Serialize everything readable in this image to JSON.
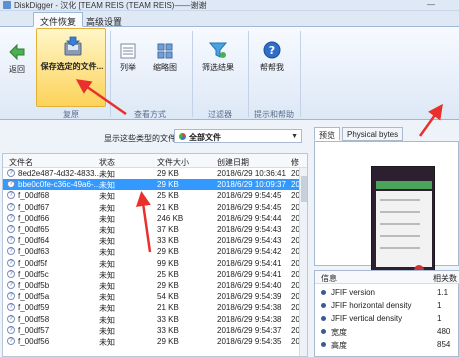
{
  "window": {
    "title": "DiskDigger - 汉化 [TEAM REIS (TEAM REIS)——谢谢",
    "minimize": "—"
  },
  "ribbon": {
    "tabs": [
      {
        "label": "文件恢复"
      },
      {
        "label": "高级设置"
      }
    ],
    "buttons": {
      "back": "返回",
      "save": "保存选定的文件...",
      "list": "列举",
      "thumbs": "缩略图",
      "filter": "筛选结果",
      "help": "帮帮我"
    },
    "groups": {
      "recover": "复原",
      "view": "查看方式",
      "filter": "过滤器",
      "help": "提示和帮助"
    }
  },
  "filter": {
    "label": "显示这些类型的文件：",
    "value": "全部文件"
  },
  "table": {
    "columns": {
      "name": "文件名",
      "status": "状态",
      "size": "文件大小",
      "created": "创建日期",
      "modified": "修"
    },
    "rows": [
      {
        "name": "8ed2e487-4d32-4833...",
        "status": "未知",
        "size": "29 KB",
        "created": "2018/6/29 10:36:41",
        "modified": "20"
      },
      {
        "name": "bbe0c0fe-c36c-49a6-...",
        "status": "未知",
        "size": "29 KB",
        "created": "2018/6/29 10:09:37",
        "modified": "20"
      },
      {
        "name": "f_00df68",
        "status": "未知",
        "size": "25 KB",
        "created": "2018/6/29 9:54:45",
        "modified": "20"
      },
      {
        "name": "f_00df67",
        "status": "未知",
        "size": "21 KB",
        "created": "2018/6/29 9:54:45",
        "modified": "20"
      },
      {
        "name": "f_00df66",
        "status": "未知",
        "size": "246 KB",
        "created": "2018/6/29 9:54:44",
        "modified": "20"
      },
      {
        "name": "f_00df65",
        "status": "未知",
        "size": "37 KB",
        "created": "2018/6/29 9:54:43",
        "modified": "20"
      },
      {
        "name": "f_00df64",
        "status": "未知",
        "size": "33 KB",
        "created": "2018/6/29 9:54:43",
        "modified": "20"
      },
      {
        "name": "f_00df63",
        "status": "未知",
        "size": "29 KB",
        "created": "2018/6/29 9:54:42",
        "modified": "20"
      },
      {
        "name": "f_00df5f",
        "status": "未知",
        "size": "99 KB",
        "created": "2018/6/29 9:54:41",
        "modified": "20"
      },
      {
        "name": "f_00df5c",
        "status": "未知",
        "size": "25 KB",
        "created": "2018/6/29 9:54:41",
        "modified": "20"
      },
      {
        "name": "f_00df5b",
        "status": "未知",
        "size": "29 KB",
        "created": "2018/6/29 9:54:40",
        "modified": "20"
      },
      {
        "name": "f_00df5a",
        "status": "未知",
        "size": "54 KB",
        "created": "2018/6/29 9:54:39",
        "modified": "20"
      },
      {
        "name": "f_00df59",
        "status": "未知",
        "size": "21 KB",
        "created": "2018/6/29 9:54:38",
        "modified": "20"
      },
      {
        "name": "f_00df58",
        "status": "未知",
        "size": "33 KB",
        "created": "2018/6/29 9:54:38",
        "modified": "20"
      },
      {
        "name": "f_00df57",
        "status": "未知",
        "size": "33 KB",
        "created": "2018/6/29 9:54:37",
        "modified": "20"
      },
      {
        "name": "f_00df56",
        "status": "未知",
        "size": "29 KB",
        "created": "2018/6/29 9:54:35",
        "modified": "20"
      }
    ]
  },
  "preview": {
    "tabs": [
      {
        "label": "预览"
      },
      {
        "label": "Physical bytes"
      }
    ],
    "props_header": {
      "key": "信息",
      "value": "相关数"
    },
    "props": [
      {
        "key": "JFIF version",
        "value": "1.1"
      },
      {
        "key": "JFIF horizontal density",
        "value": "1"
      },
      {
        "key": "JFIF vertical density",
        "value": "1"
      },
      {
        "key": "宽度",
        "value": "480"
      },
      {
        "key": "高度",
        "value": "854"
      }
    ]
  },
  "colors": {
    "selection": "#3399ff",
    "annotation_arrow": "#e8302c",
    "save_button": "#fcd35a"
  }
}
